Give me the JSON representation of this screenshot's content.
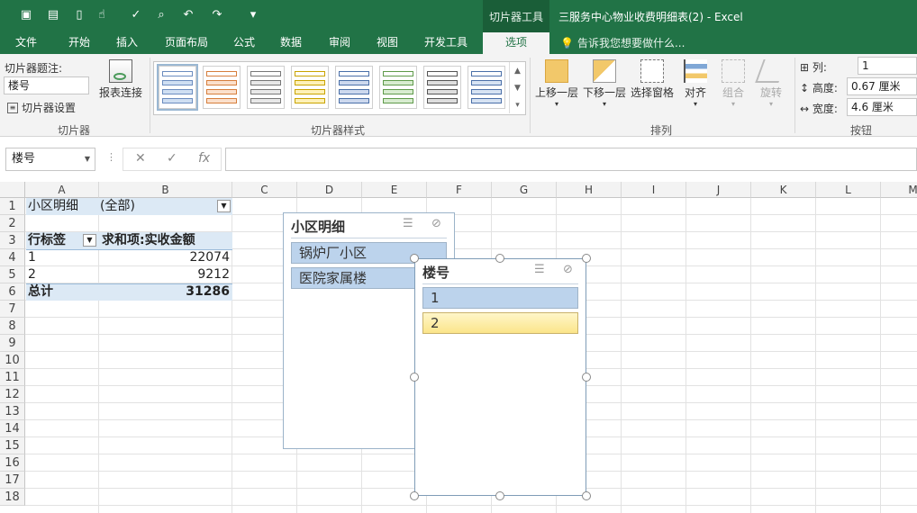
{
  "titlebar": {
    "context_tool": "切片器工具",
    "title": "三服务中心物业收费明细表(2) - Excel",
    "qat": [
      {
        "icon": "save-icon",
        "glyph": "▣"
      },
      {
        "icon": "open-icon",
        "glyph": "▤"
      },
      {
        "icon": "new-icon",
        "glyph": "▯"
      },
      {
        "icon": "touch-icon",
        "glyph": "☝"
      },
      {
        "icon": "spell-check-icon",
        "glyph": "✓"
      },
      {
        "icon": "print-preview-icon",
        "glyph": "⌕"
      },
      {
        "icon": "undo-icon",
        "glyph": "↶"
      },
      {
        "icon": "redo-icon",
        "glyph": "↷"
      },
      {
        "icon": "customize-qat-icon",
        "glyph": "▾"
      }
    ]
  },
  "tabs": [
    "文件",
    "开始",
    "插入",
    "页面布局",
    "公式",
    "数据",
    "审阅",
    "视图",
    "开发工具",
    "选项"
  ],
  "tellme": "告诉我您想要做什么...",
  "ribbon": {
    "slicer_group": {
      "caption_label": "切片器题注:",
      "caption_value": "楼号",
      "settings": "切片器设置",
      "report_conn": "报表连接",
      "label": "切片器"
    },
    "styles_group": {
      "label": "切片器样式"
    },
    "arrange_group": {
      "label": "排列",
      "bring_forward": "上移一层",
      "send_backward": "下移一层",
      "selection_pane": "选择窗格",
      "align": "对齐",
      "group": "组合",
      "rotate": "旋转"
    },
    "buttons_group": {
      "label": "按钮",
      "columns_label": "列:",
      "columns_value": "1",
      "height_label": "高度:",
      "height_value": "0.67 厘米",
      "width_label": "宽度:",
      "width_value": "4.6 厘米"
    }
  },
  "formula_bar": {
    "name_box": "楼号",
    "formula": ""
  },
  "columns": [
    "A",
    "B",
    "C",
    "D",
    "E",
    "F",
    "G",
    "H",
    "I",
    "J",
    "K",
    "L",
    "M"
  ],
  "rows": [
    "1",
    "2",
    "3",
    "4",
    "5",
    "6",
    "7",
    "8",
    "9",
    "10",
    "11",
    "12",
    "13",
    "14",
    "15",
    "16",
    "17",
    "18"
  ],
  "pivot": {
    "filter_label": "小区明细",
    "filter_value": "(全部)",
    "row_label": "行标签",
    "value_header": "求和项:实收金额",
    "rows": [
      {
        "label": "1",
        "value": "22074"
      },
      {
        "label": "2",
        "value": "9212"
      }
    ],
    "total_label": "总计",
    "total_value": "31286"
  },
  "slicer1": {
    "title": "小区明细",
    "items": [
      "锅炉厂小区",
      "医院家属楼"
    ]
  },
  "slicer2": {
    "title": "楼号",
    "items": [
      "1",
      "2"
    ]
  },
  "colors": {
    "excel_green": "#217346",
    "slicer_item": "#bcd3ec",
    "hover_item": "#fbe58a",
    "pivot_band": "#dce9f5"
  }
}
